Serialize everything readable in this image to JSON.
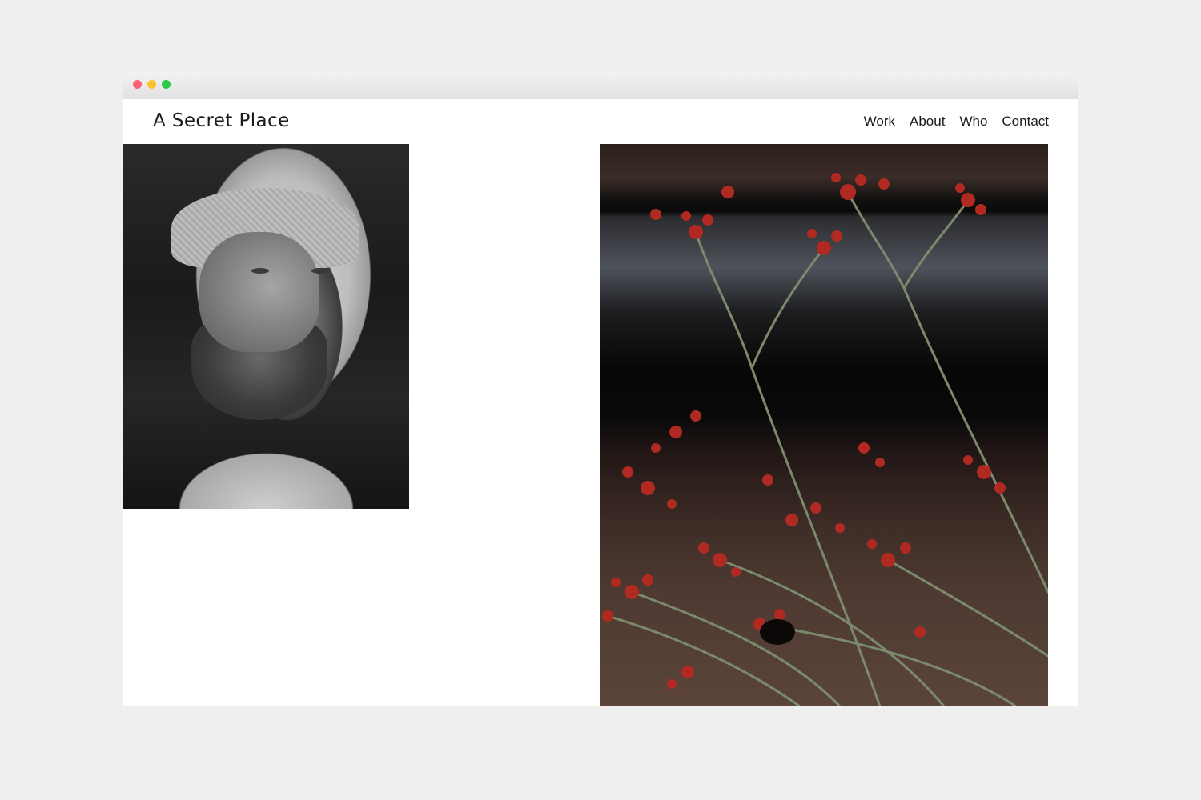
{
  "window": {
    "controls": {
      "close_color": "#fc5f75",
      "minimize_color": "#fdc12f",
      "maximize_color": "#2bc848"
    }
  },
  "header": {
    "title": "A Secret Place"
  },
  "nav": {
    "items": [
      {
        "label": "Work"
      },
      {
        "label": "About"
      },
      {
        "label": "Who"
      },
      {
        "label": "Contact"
      }
    ]
  },
  "gallery": {
    "photos": [
      {
        "subject": "black-and-white portrait of bearded man in hood and knit beanie"
      },
      {
        "subject": "red kangaroo paw flower stems on wooden windowsill"
      }
    ]
  }
}
